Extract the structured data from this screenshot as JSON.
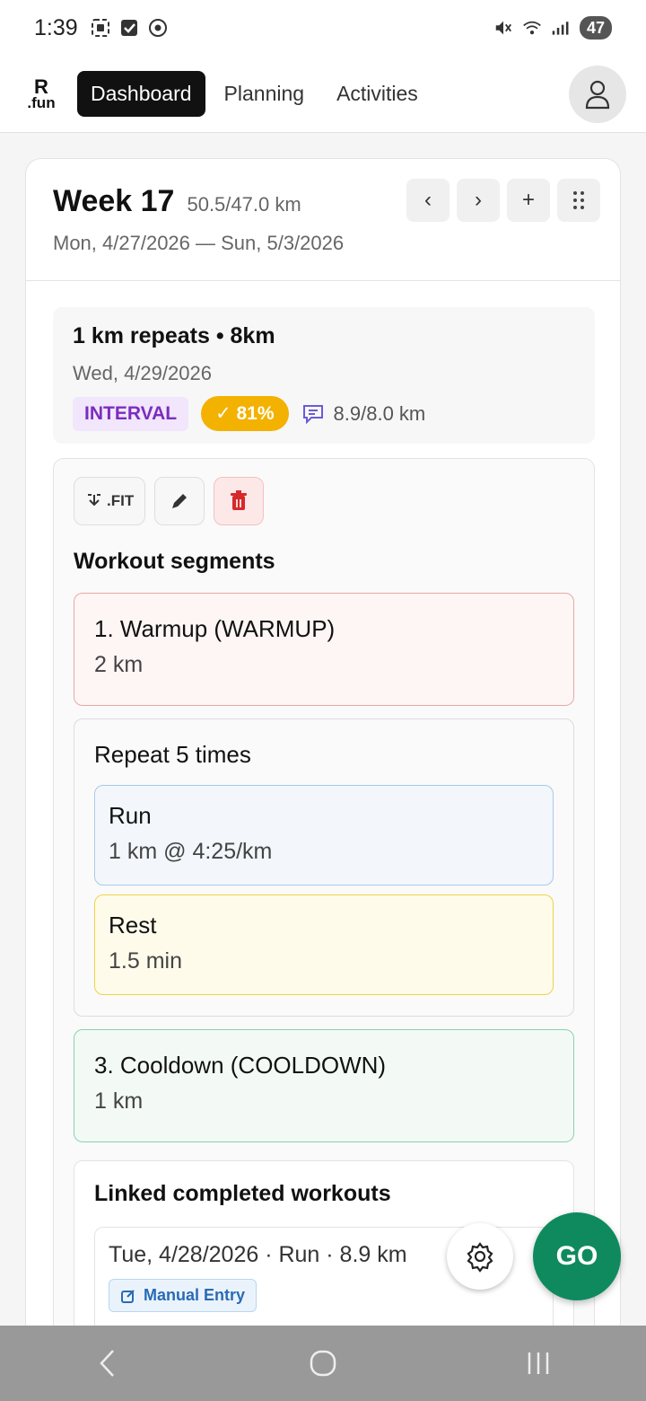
{
  "status_bar": {
    "time": "1:39",
    "battery": "47"
  },
  "header": {
    "logo_top": "R",
    "logo_bottom": ".fun",
    "tabs": [
      {
        "label": "Dashboard",
        "active": true
      },
      {
        "label": "Planning",
        "active": false
      },
      {
        "label": "Activities",
        "active": false
      }
    ]
  },
  "week": {
    "title": "Week 17",
    "km": "50.5/47.0 km",
    "dates": "Mon, 4/27/2026 — Sun, 5/3/2026",
    "controls": {
      "prev": "‹",
      "next": "›",
      "add": "+"
    }
  },
  "workout": {
    "title": "1 km repeats • 8km",
    "date": "Wed, 4/29/2026",
    "type_tag": "INTERVAL",
    "completion": "✓ 81%",
    "distance": "8.9/8.0 km"
  },
  "actions": {
    "fit_label": ".FIT"
  },
  "segments": {
    "section_title": "Workout segments",
    "warmup": {
      "title": "1. Warmup (WARMUP)",
      "sub": "2 km"
    },
    "repeat": {
      "title": "Repeat 5 times",
      "run": {
        "title": "Run",
        "sub": "1 km @ 4:25/km"
      },
      "rest": {
        "title": "Rest",
        "sub": "1.5 min"
      }
    },
    "cooldown": {
      "title": "3. Cooldown (COOLDOWN)",
      "sub": "1 km"
    }
  },
  "linked": {
    "title": "Linked completed workouts",
    "item": "Tue, 4/28/2026 · Run · 8.9 km",
    "badge": "Manual Entry"
  },
  "fab": {
    "go": "GO"
  },
  "colors": {
    "accent_go": "#0f8a5f",
    "interval_tag": "#7a2dbf",
    "completion_tag": "#f3b100"
  }
}
